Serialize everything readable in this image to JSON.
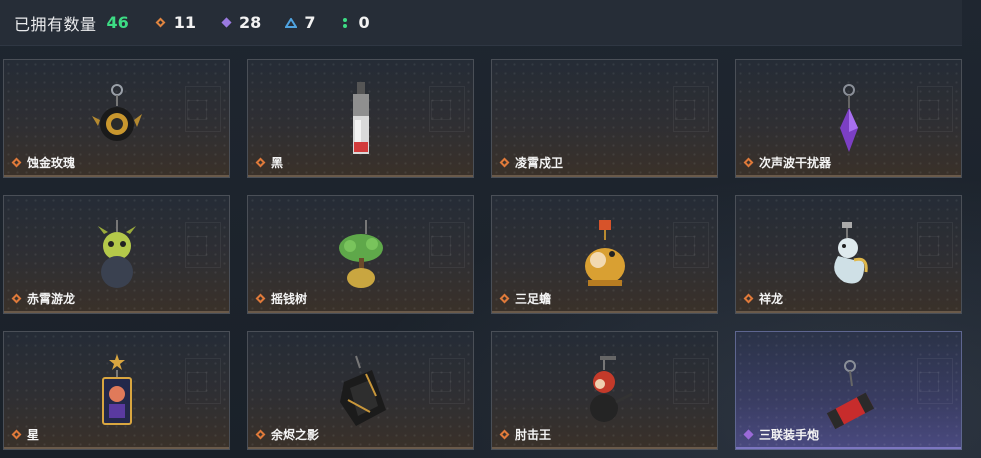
{
  "header": {
    "owned_label": "已拥有数量",
    "owned_count": "46",
    "stats": [
      {
        "icon": "orange-diamond-icon",
        "value": "11",
        "color": "#e08540"
      },
      {
        "icon": "purple-diamond-icon",
        "value": "28",
        "color": "#9a7ae0"
      },
      {
        "icon": "blue-triangle-icon",
        "value": "7",
        "color": "#4fa3e0"
      },
      {
        "icon": "green-dots-icon",
        "value": "0",
        "color": "#3ddc84"
      }
    ]
  },
  "cards": [
    {
      "name": "蚀金玫瑰",
      "rarity": "orange",
      "charm": "rose-charm-icon"
    },
    {
      "name": "黑",
      "rarity": "orange",
      "charm": "black-device-charm-icon"
    },
    {
      "name": "凌霄戍卫",
      "rarity": "orange",
      "charm": ""
    },
    {
      "name": "次声波干扰器",
      "rarity": "orange",
      "charm": "purple-crystal-charm-icon"
    },
    {
      "name": "赤霄游龙",
      "rarity": "orange",
      "charm": "green-dragon-charm-icon"
    },
    {
      "name": "摇钱树",
      "rarity": "orange",
      "charm": "money-tree-charm-icon"
    },
    {
      "name": "三足蟾",
      "rarity": "orange",
      "charm": "golden-toad-charm-icon"
    },
    {
      "name": "祥龙",
      "rarity": "orange",
      "charm": "white-dragon-charm-icon"
    },
    {
      "name": "星",
      "rarity": "orange",
      "charm": "star-card-charm-icon"
    },
    {
      "name": "余烬之影",
      "rarity": "orange",
      "charm": "ember-shadow-charm-icon"
    },
    {
      "name": "肘击王",
      "rarity": "orange",
      "charm": "elbow-king-charm-icon"
    },
    {
      "name": "三联装手炮",
      "rarity": "purple",
      "charm": "hand-cannon-charm-icon"
    }
  ]
}
